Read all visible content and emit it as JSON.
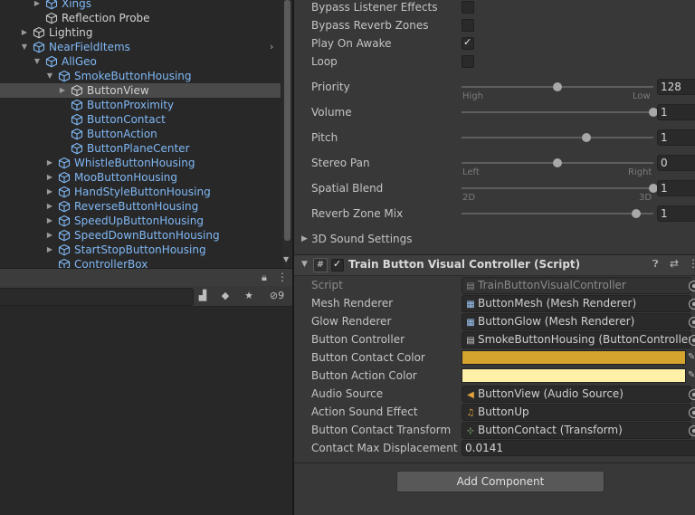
{
  "hierarchy": {
    "items": [
      {
        "label": "Xings",
        "indent": 3,
        "arrow": "right",
        "color": "blue",
        "selected": false
      },
      {
        "label": "Reflection Probe",
        "indent": 3,
        "arrow": "",
        "color": "white",
        "selected": false
      },
      {
        "label": "Lighting",
        "indent": 2,
        "arrow": "right",
        "color": "white",
        "selected": false
      },
      {
        "label": "NearFieldItems",
        "indent": 2,
        "arrow": "down",
        "color": "blue",
        "selected": false,
        "prefab_open": true
      },
      {
        "label": "AllGeo",
        "indent": 3,
        "arrow": "down",
        "color": "blue",
        "selected": false
      },
      {
        "label": "SmokeButtonHousing",
        "indent": 4,
        "arrow": "down",
        "color": "blue",
        "selected": false
      },
      {
        "label": "ButtonView",
        "indent": 5,
        "arrow": "right",
        "color": "white",
        "selected": true
      },
      {
        "label": "ButtonProximity",
        "indent": 5,
        "arrow": "",
        "color": "blue",
        "selected": false
      },
      {
        "label": "ButtonContact",
        "indent": 5,
        "arrow": "",
        "color": "blue",
        "selected": false
      },
      {
        "label": "ButtonAction",
        "indent": 5,
        "arrow": "",
        "color": "blue",
        "selected": false
      },
      {
        "label": "ButtonPlaneCenter",
        "indent": 5,
        "arrow": "",
        "color": "blue",
        "selected": false
      },
      {
        "label": "WhistleButtonHousing",
        "indent": 4,
        "arrow": "right",
        "color": "blue",
        "selected": false
      },
      {
        "label": "MooButtonHousing",
        "indent": 4,
        "arrow": "right",
        "color": "blue",
        "selected": false
      },
      {
        "label": "HandStyleButtonHousing",
        "indent": 4,
        "arrow": "right",
        "color": "blue",
        "selected": false
      },
      {
        "label": "ReverseButtonHousing",
        "indent": 4,
        "arrow": "right",
        "color": "blue",
        "selected": false
      },
      {
        "label": "SpeedUpButtonHousing",
        "indent": 4,
        "arrow": "right",
        "color": "blue",
        "selected": false
      },
      {
        "label": "SpeedDownButtonHousing",
        "indent": 4,
        "arrow": "right",
        "color": "blue",
        "selected": false
      },
      {
        "label": "StartStopButtonHousing",
        "indent": 4,
        "arrow": "right",
        "color": "blue",
        "selected": false
      },
      {
        "label": "ControllerBox",
        "indent": 4,
        "arrow": "",
        "color": "blue",
        "selected": false
      }
    ]
  },
  "project": {
    "search_value": "",
    "hidden_count": "9"
  },
  "audio_source": {
    "bypass_listener_effects": {
      "label": "Bypass Listener Effects",
      "checked": false
    },
    "bypass_reverb_zones": {
      "label": "Bypass Reverb Zones",
      "checked": false
    },
    "play_on_awake": {
      "label": "Play On Awake",
      "checked": true
    },
    "loop": {
      "label": "Loop",
      "checked": false
    },
    "priority": {
      "label": "Priority",
      "value": "128",
      "fraction": 0.5,
      "hint_left": "High",
      "hint_right": "Low"
    },
    "volume": {
      "label": "Volume",
      "value": "1",
      "fraction": 1.0
    },
    "pitch": {
      "label": "Pitch",
      "value": "1",
      "fraction": 0.653
    },
    "stereo_pan": {
      "label": "Stereo Pan",
      "value": "0",
      "fraction": 0.5,
      "hint_left": "Left",
      "hint_right": "Right"
    },
    "spatial_blend": {
      "label": "Spatial Blend",
      "value": "1",
      "fraction": 1.0,
      "hint_left": "2D",
      "hint_right": "3D"
    },
    "reverb_zone_mix": {
      "label": "Reverb Zone Mix",
      "value": "1",
      "fraction": 0.909
    },
    "sound_settings_label": "3D Sound Settings"
  },
  "component": {
    "title": "Train Button Visual Controller (Script)",
    "enabled": true,
    "fields": {
      "script": {
        "label": "Script",
        "value": "TrainButtonVisualController"
      },
      "mesh_renderer": {
        "label": "Mesh Renderer",
        "value": "ButtonMesh (Mesh Renderer)"
      },
      "glow_renderer": {
        "label": "Glow Renderer",
        "value": "ButtonGlow (Mesh Renderer)"
      },
      "button_controller": {
        "label": "Button Controller",
        "value": "SmokeButtonHousing (ButtonController)"
      },
      "button_contact_color": {
        "label": "Button Contact Color",
        "color": "#d4a42e"
      },
      "button_action_color": {
        "label": "Button Action Color",
        "color": "#fff0a8"
      },
      "audio_source": {
        "label": "Audio Source",
        "value": "ButtonView (Audio Source)"
      },
      "action_sound_effect": {
        "label": "Action Sound Effect",
        "value": "ButtonUp"
      },
      "button_contact_transform": {
        "label": "Button Contact Transform",
        "value": "ButtonContact (Transform)"
      },
      "contact_max_displacement": {
        "label": "Contact Max Displacement D",
        "value": "0.0141"
      }
    }
  },
  "add_component_label": "Add Component",
  "colors": {
    "blue_text": "#80b8f5",
    "selection": "#4a4a4a"
  }
}
